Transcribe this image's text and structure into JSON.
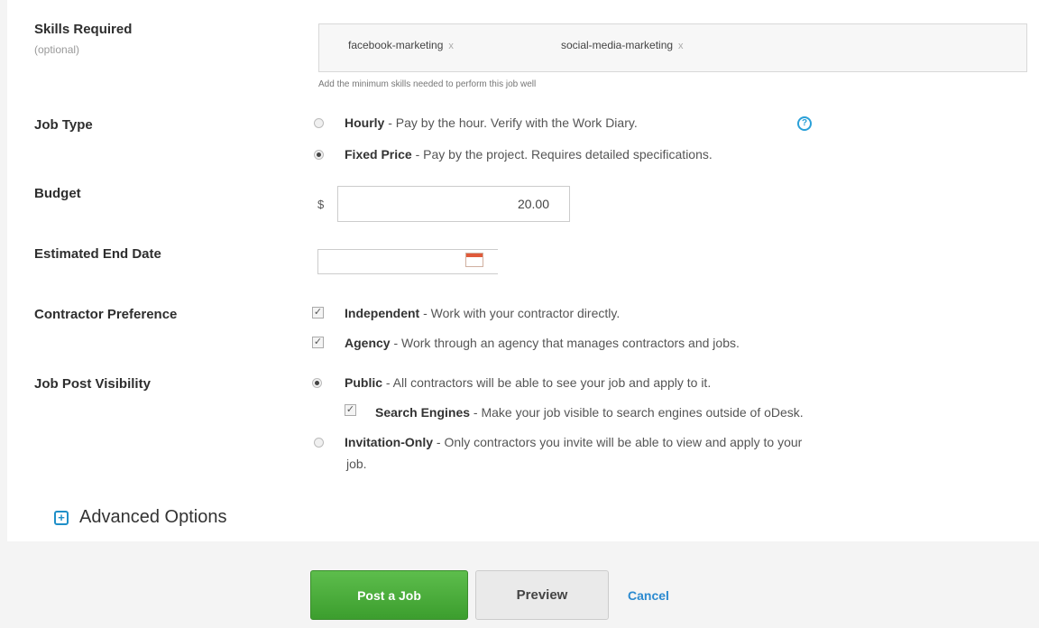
{
  "skills": {
    "label": "Skills Required",
    "sublabel": "(optional)",
    "tags": [
      "facebook-marketing",
      "social-media-marketing"
    ],
    "remove_glyph": "x",
    "hint": "Add the minimum skills needed to perform this job well"
  },
  "job_type": {
    "label": "Job Type",
    "options": [
      {
        "title": "Hourly",
        "desc": " - Pay by the hour. Verify with the Work Diary.",
        "selected": false
      },
      {
        "title": "Fixed Price",
        "desc": " - Pay by the project. Requires detailed specifications.",
        "selected": true
      }
    ],
    "help_icon": "?"
  },
  "budget": {
    "label": "Budget",
    "currency": "$",
    "value": "20.00"
  },
  "end_date": {
    "label": "Estimated End Date",
    "value": "",
    "icon": "calendar-icon"
  },
  "contractor": {
    "label": "Contractor Preference",
    "options": [
      {
        "title": "Independent",
        "desc": " - Work with your contractor directly.",
        "checked": true
      },
      {
        "title": "Agency",
        "desc": " - Work through an agency that manages contractors and jobs.",
        "checked": true
      }
    ]
  },
  "visibility": {
    "label": "Job Post Visibility",
    "public": {
      "title": "Public",
      "desc": " - All contractors will be able to see your job and apply to it.",
      "selected": true
    },
    "search_engines": {
      "title": "Search Engines",
      "desc": " - Make your job visible to search engines outside of oDesk.",
      "checked": true
    },
    "invitation": {
      "title": "Invitation-Only",
      "desc_line1": " - Only contractors you invite will be able to view and apply to your",
      "desc_line2": "job.",
      "selected": false
    }
  },
  "advanced": {
    "label": "Advanced Options",
    "icon": "plus-icon"
  },
  "actions": {
    "post": "Post a Job",
    "preview": "Preview",
    "cancel": "Cancel"
  }
}
